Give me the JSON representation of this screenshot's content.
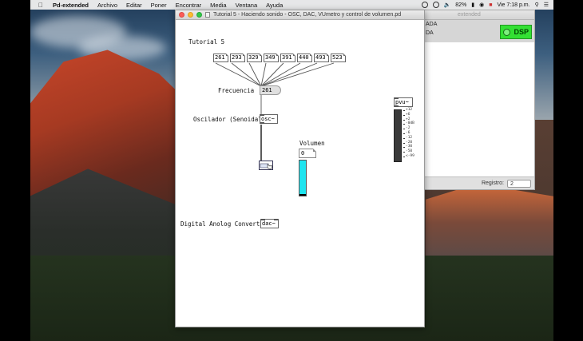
{
  "menubar": {
    "app": "Pd-extended",
    "items": [
      "Archivo",
      "Editar",
      "Poner",
      "Encontrar",
      "Media",
      "Ventana",
      "Ayuda"
    ],
    "battery": "82%",
    "clock": "Vie 7:18 p.m."
  },
  "main_window": {
    "title_fragment": "extended",
    "line1": "ADA",
    "line2": "DA",
    "dsp_label": "DSP",
    "dsp_on": true,
    "log_label": "Registro:",
    "log_level": "2"
  },
  "patch": {
    "title": "Tutorial 5 - Haciendo sonido - OSC, DAC, VUmetro y control de volumen.pd",
    "comments": {
      "tutorial": "Tutorial 5",
      "frecuencia": "Frecuencia",
      "oscilador": "Oscilador (Senoidal)",
      "volumen": "Volumen",
      "dac": "Digital Anolog Converter"
    },
    "messages": [
      "261",
      "293",
      "329",
      "349",
      "391",
      "440",
      "493",
      "523"
    ],
    "frequency_value": "261",
    "osc_object": "osc~",
    "dac_object": "dac~",
    "volume_value": "0",
    "volume_level": 1.0,
    "vu_object": "pvu~",
    "vu_scale": [
      "+12",
      "+6",
      "+2",
      "-0dB",
      "-2",
      "-6",
      "-12",
      "-20",
      "-30",
      "-50",
      "<-99"
    ]
  },
  "colors": {
    "dsp_on": "#33e033",
    "volume_fill": "#1fe4ef"
  }
}
